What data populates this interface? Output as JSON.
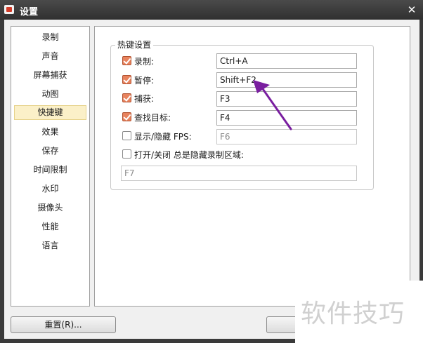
{
  "window": {
    "title": "设置"
  },
  "sidebar": {
    "items": [
      {
        "label": "录制"
      },
      {
        "label": "声音"
      },
      {
        "label": "屏幕捕获"
      },
      {
        "label": "动图"
      },
      {
        "label": "快捷键",
        "active": true
      },
      {
        "label": "效果"
      },
      {
        "label": "保存"
      },
      {
        "label": "时间限制"
      },
      {
        "label": "水印"
      },
      {
        "label": "摄像头"
      },
      {
        "label": "性能"
      },
      {
        "label": "语言"
      }
    ]
  },
  "hotkeys": {
    "group_title": "热键设置",
    "rows": [
      {
        "label": "录制:",
        "checked": true,
        "value": "Ctrl+A",
        "enabled": true
      },
      {
        "label": "暂停:",
        "checked": true,
        "value": "Shift+F2",
        "enabled": true
      },
      {
        "label": "捕获:",
        "checked": true,
        "value": "F3",
        "enabled": true
      },
      {
        "label": "查找目标:",
        "checked": true,
        "value": "F4",
        "enabled": true
      },
      {
        "label": "显示/隐藏 FPS:",
        "checked": false,
        "value": "F6",
        "enabled": false
      }
    ],
    "toggle_area": {
      "label": "打开/关闭 总是隐藏录制区域:",
      "checked": false,
      "value": "F7"
    }
  },
  "buttons": {
    "reset": "重置(R)...",
    "ok_partial": "确"
  },
  "annotation": {
    "arrow_color": "#7a1fa0"
  },
  "watermark": "软件技巧"
}
